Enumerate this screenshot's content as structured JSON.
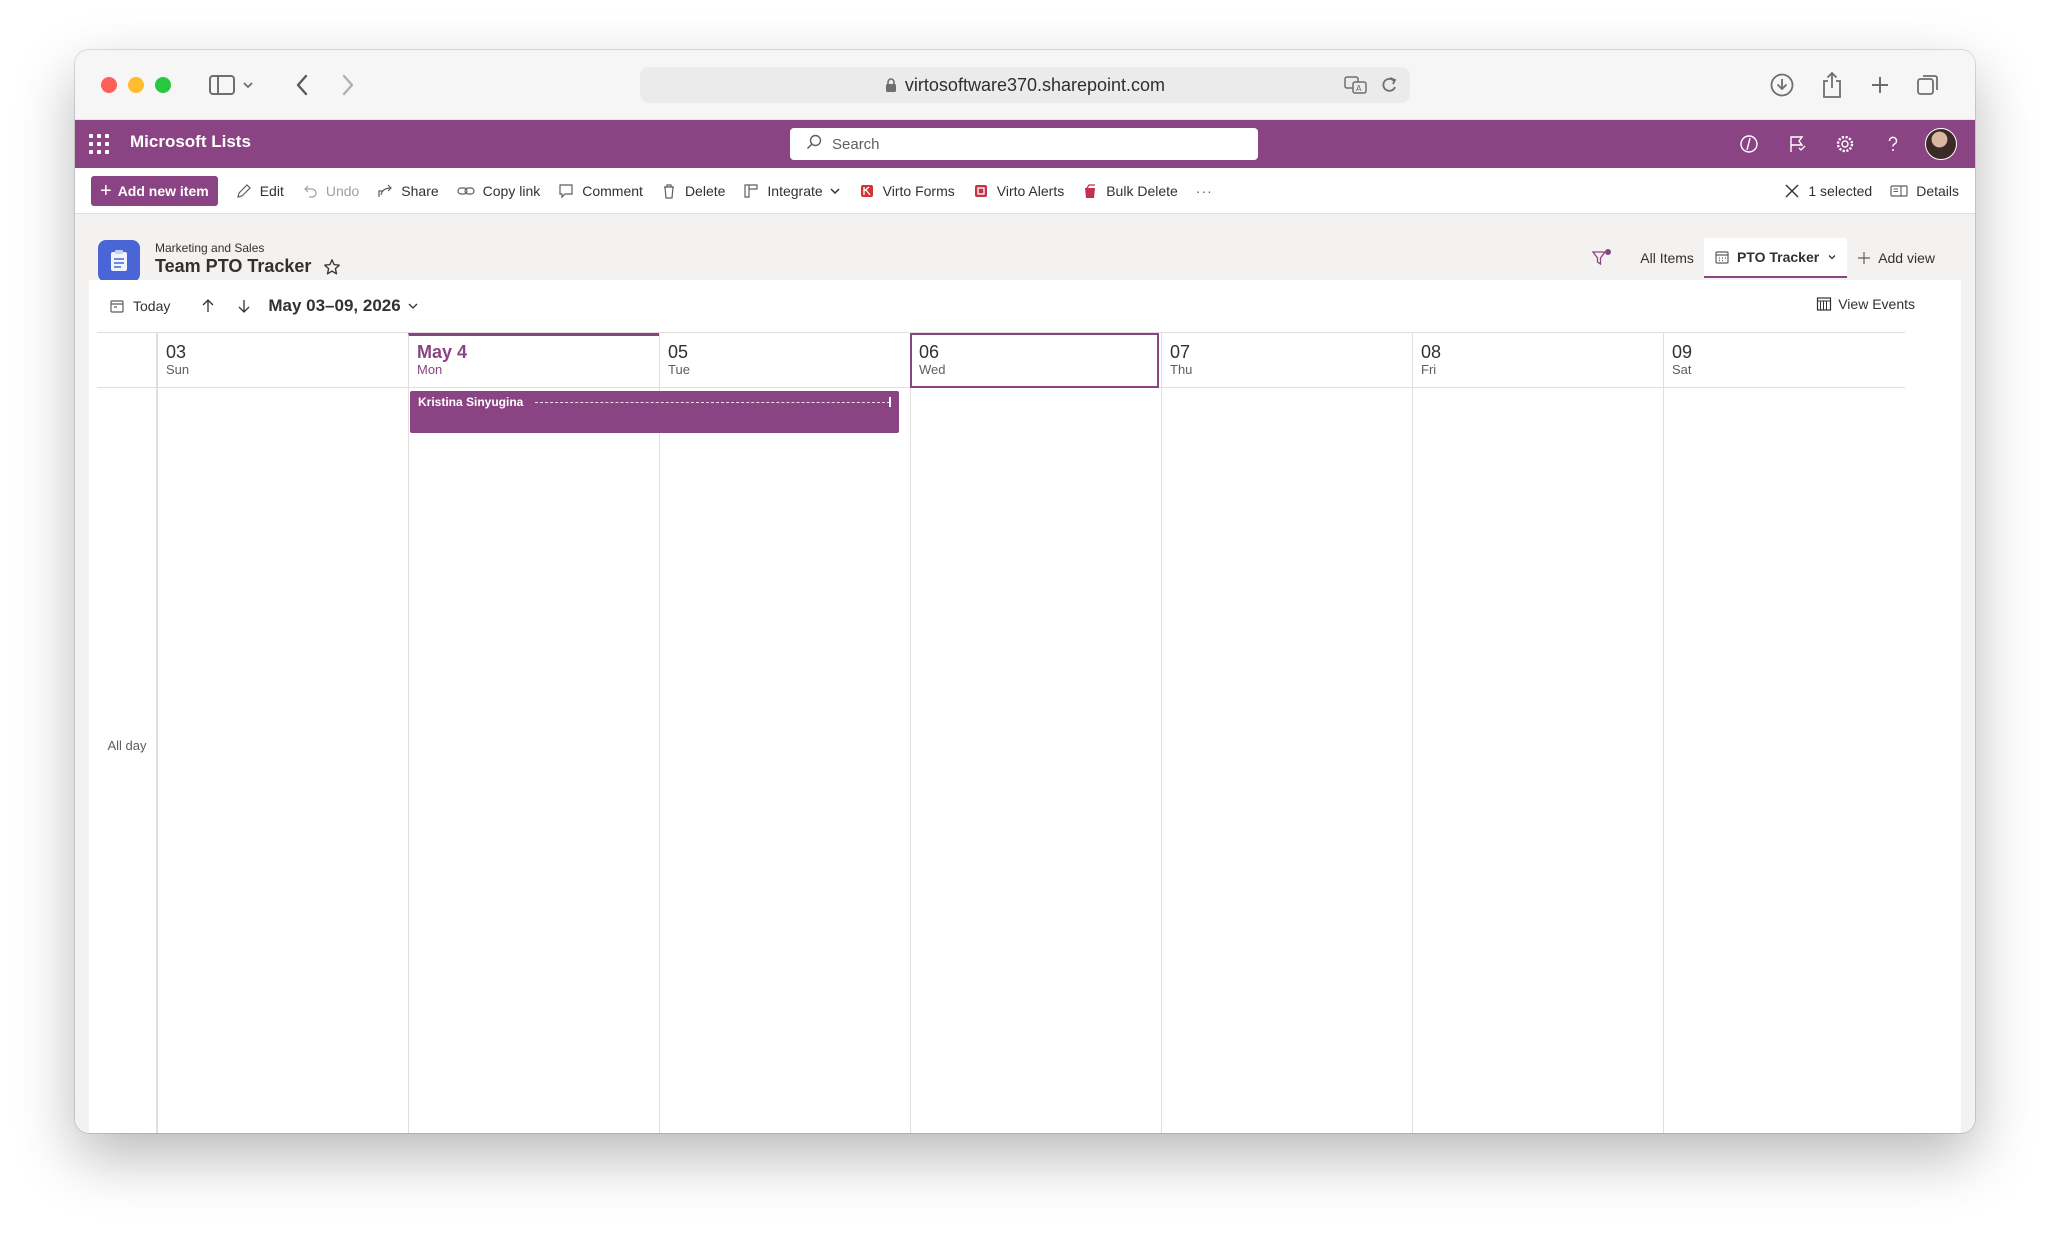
{
  "browser": {
    "url": "virtosoftware370.sharepoint.com"
  },
  "suite": {
    "app_name": "Microsoft Lists",
    "search_placeholder": "Search"
  },
  "commands": {
    "add_new_item": "Add new item",
    "edit": "Edit",
    "undo": "Undo",
    "share": "Share",
    "copy_link": "Copy link",
    "comment": "Comment",
    "delete": "Delete",
    "integrate": "Integrate",
    "virto_forms": "Virto Forms",
    "virto_alerts": "Virto Alerts",
    "bulk_delete": "Bulk Delete",
    "more": "···",
    "selected": "1 selected",
    "details": "Details"
  },
  "list": {
    "site": "Marketing and Sales",
    "title": "Team PTO Tracker"
  },
  "views": {
    "all_items": "All Items",
    "current": "PTO Tracker",
    "add_view": "Add view"
  },
  "calendar": {
    "today": "Today",
    "range": "May 03–09, 2026",
    "view_events": "View Events",
    "all_day": "All day",
    "days": [
      {
        "num": "03",
        "name": "Sun"
      },
      {
        "num": "May 4",
        "name": "Mon"
      },
      {
        "num": "05",
        "name": "Tue"
      },
      {
        "num": "06",
        "name": "Wed"
      },
      {
        "num": "07",
        "name": "Thu"
      },
      {
        "num": "08",
        "name": "Fri"
      },
      {
        "num": "09",
        "name": "Sat"
      }
    ],
    "event": {
      "title": "Kristina Sinyugina"
    }
  },
  "colors": {
    "brand": "#8b4483",
    "list_icon": "#4a66d6"
  }
}
